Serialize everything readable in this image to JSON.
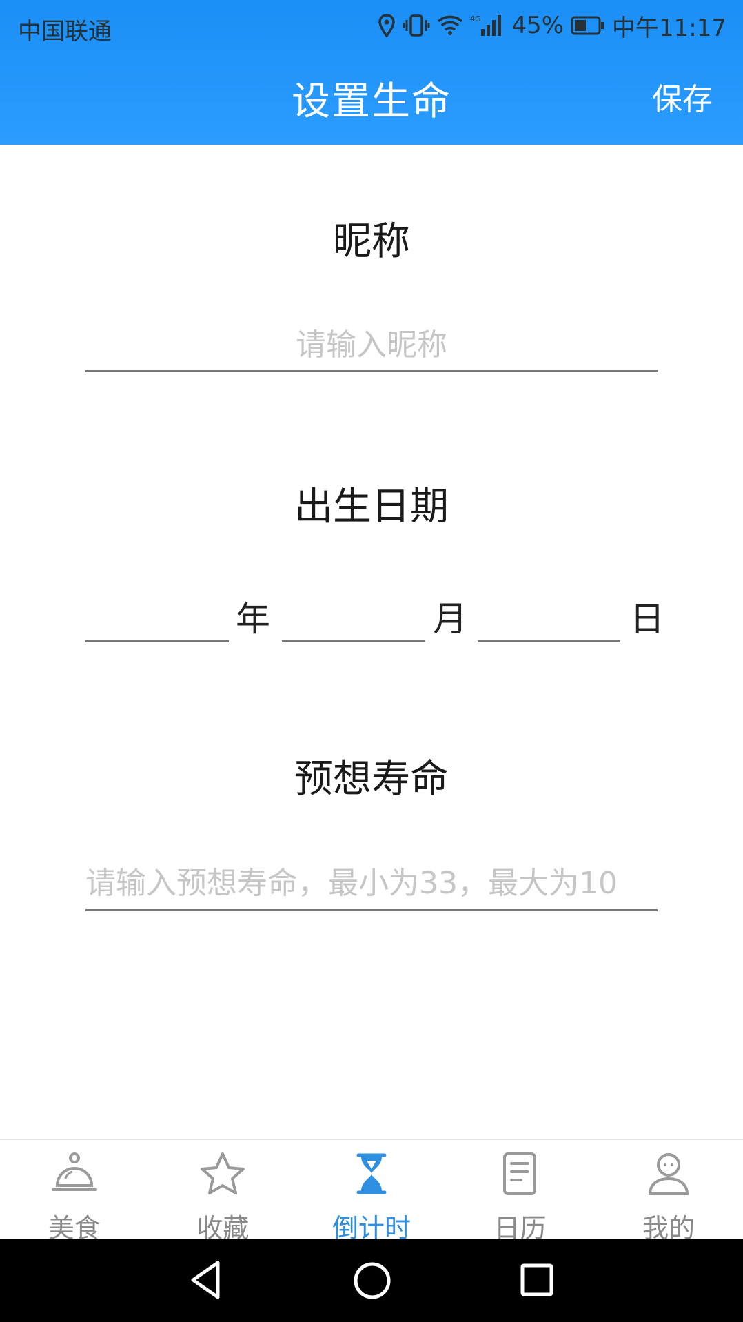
{
  "status_bar": {
    "carrier": "中国联通",
    "network": "4G",
    "battery": "45%",
    "time": "中午11:17"
  },
  "header": {
    "title": "设置生命",
    "save_label": "保存"
  },
  "form": {
    "nickname": {
      "label": "昵称",
      "value": "",
      "placeholder": "请输入昵称"
    },
    "birthdate": {
      "label": "出生日期",
      "year_unit": "年",
      "month_unit": "月",
      "day_unit": "日",
      "year_value": "",
      "month_value": "",
      "day_value": ""
    },
    "lifespan": {
      "label": "预想寿命",
      "value": "",
      "placeholder": "请输入预想寿命，最小为33，最大为10"
    }
  },
  "bottom_nav": {
    "items": [
      {
        "label": "美食",
        "icon": "dish-cover-icon",
        "active": false
      },
      {
        "label": "收藏",
        "icon": "star-icon",
        "active": false
      },
      {
        "label": "倒计时",
        "icon": "hourglass-icon",
        "active": true
      },
      {
        "label": "日历",
        "icon": "document-icon",
        "active": false
      },
      {
        "label": "我的",
        "icon": "person-icon",
        "active": false
      }
    ]
  },
  "colors": {
    "header_blue": "#1a8ff5",
    "active_tab": "#2f8fe0",
    "inactive_tab": "#8a8a8a"
  }
}
